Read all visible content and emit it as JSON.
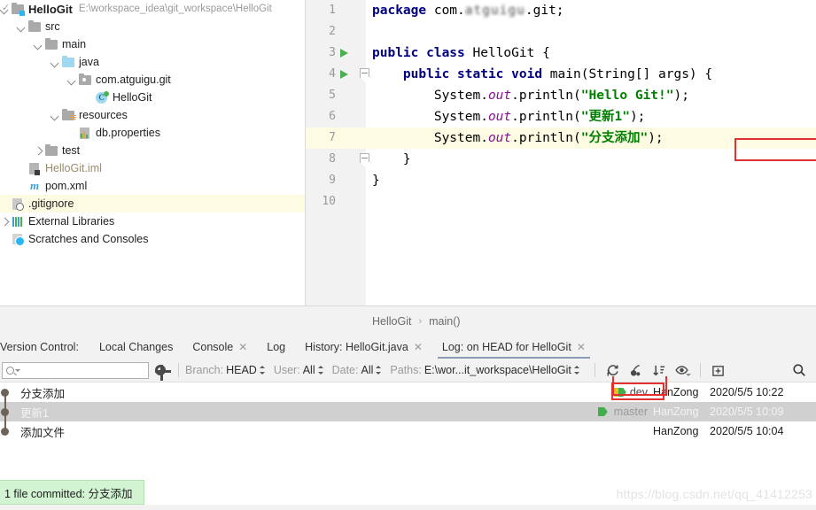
{
  "project_tree": {
    "rows": [
      {
        "label": "HelloGit",
        "path_note": "E:\\workspace_idea\\git_workspace\\HelloGit",
        "icon": "project-folder-icon",
        "indent": 13,
        "arrow": "down",
        "bold": true,
        "selected": false
      },
      {
        "label": "src",
        "path_note": "",
        "icon": "folder-gray-icon",
        "indent": 32,
        "arrow": "down",
        "bold": false,
        "selected": false
      },
      {
        "label": "main",
        "path_note": "",
        "icon": "folder-gray-icon",
        "indent": 51,
        "arrow": "down",
        "bold": false,
        "selected": false
      },
      {
        "label": "java",
        "path_note": "",
        "icon": "folder-source-icon",
        "indent": 70,
        "arrow": "down",
        "bold": false,
        "selected": false
      },
      {
        "label": "com.atguigu.git",
        "path_note": "",
        "icon": "package-icon",
        "indent": 89,
        "arrow": "down",
        "bold": false,
        "selected": false
      },
      {
        "label": "HelloGit",
        "path_note": "",
        "icon": "java-class-icon",
        "indent": 108,
        "arrow": "none",
        "bold": false,
        "selected": false
      },
      {
        "label": "resources",
        "path_note": "",
        "icon": "folder-resources-icon",
        "indent": 70,
        "arrow": "down",
        "bold": false,
        "selected": false
      },
      {
        "label": "db.properties",
        "path_note": "",
        "icon": "properties-file-icon",
        "indent": 89,
        "arrow": "none",
        "bold": false,
        "selected": false
      },
      {
        "label": "test",
        "path_note": "",
        "icon": "folder-gray-icon",
        "indent": 51,
        "arrow": "right",
        "bold": false,
        "selected": false
      },
      {
        "label": "HelloGit.iml",
        "path_note": "",
        "icon": "iml-file-icon",
        "indent": 32,
        "arrow": "none",
        "bold": false,
        "selected": false,
        "muted": true
      },
      {
        "label": "pom.xml",
        "path_note": "",
        "icon": "maven-icon",
        "indent": 32,
        "arrow": "none",
        "bold": false,
        "selected": false
      },
      {
        "label": ".gitignore",
        "path_note": "",
        "icon": "gitignore-icon",
        "indent": 13,
        "arrow": "none",
        "bold": false,
        "selected": true
      },
      {
        "label": "External Libraries",
        "path_note": "",
        "icon": "external-libraries-icon",
        "indent": 13,
        "arrow": "right",
        "bold": false,
        "selected": false
      },
      {
        "label": "Scratches and Consoles",
        "path_note": "",
        "icon": "scratches-icon",
        "indent": 13,
        "arrow": "none",
        "bold": false,
        "selected": false
      }
    ]
  },
  "editor": {
    "line_numbers": [
      "1",
      "2",
      "3",
      "4",
      "5",
      "6",
      "7",
      "8",
      "9",
      "10"
    ],
    "lines": [
      {
        "n": 1,
        "tokens": [
          {
            "t": "package ",
            "c": "kw"
          },
          {
            "t": "com.",
            "c": "plain"
          },
          {
            "t": "atguigu",
            "c": "blur"
          },
          {
            "t": ".git;",
            "c": "plain"
          }
        ]
      },
      {
        "n": 2,
        "tokens": []
      },
      {
        "n": 3,
        "tokens": [
          {
            "t": "public class ",
            "c": "kw"
          },
          {
            "t": "HelloGit {",
            "c": "plain"
          }
        ]
      },
      {
        "n": 4,
        "tokens": [
          {
            "t": "    ",
            "c": "plain"
          },
          {
            "t": "public static void ",
            "c": "kw"
          },
          {
            "t": "main(String[] args) {",
            "c": "plain"
          }
        ]
      },
      {
        "n": 5,
        "tokens": [
          {
            "t": "        System.",
            "c": "plain"
          },
          {
            "t": "out",
            "c": "fld"
          },
          {
            "t": ".println(",
            "c": "plain"
          },
          {
            "t": "\"Hello Git!\"",
            "c": "str"
          },
          {
            "t": ");",
            "c": "plain"
          }
        ]
      },
      {
        "n": 6,
        "tokens": [
          {
            "t": "        System.",
            "c": "plain"
          },
          {
            "t": "out",
            "c": "fld"
          },
          {
            "t": ".println(",
            "c": "plain"
          },
          {
            "t": "\"更新1\"",
            "c": "str"
          },
          {
            "t": ");",
            "c": "plain"
          }
        ]
      },
      {
        "n": 7,
        "tokens": [
          {
            "t": "        System.",
            "c": "plain"
          },
          {
            "t": "out",
            "c": "fld"
          },
          {
            "t": ".println(",
            "c": "plain"
          },
          {
            "t": "\"分支添加\"",
            "c": "str"
          },
          {
            "t": ");",
            "c": "plain"
          }
        ]
      },
      {
        "n": 8,
        "tokens": [
          {
            "t": "    }",
            "c": "plain"
          }
        ]
      },
      {
        "n": 9,
        "tokens": [
          {
            "t": "}",
            "c": "plain"
          }
        ]
      },
      {
        "n": 10,
        "tokens": []
      }
    ],
    "highlighted_line": 7,
    "run_gutter_lines": [
      3,
      4
    ],
    "fold_gutter_lines": [
      4,
      8
    ],
    "highlight_box_color": "#e03030"
  },
  "breadcrumb": {
    "items": [
      "HelloGit",
      "main()"
    ],
    "separator": "›"
  },
  "vcs": {
    "title": "Version Control:",
    "tabs": [
      {
        "label": "Local Changes",
        "closable": false,
        "active": false
      },
      {
        "label": "Console",
        "closable": true,
        "active": false
      },
      {
        "label": "Log",
        "closable": false,
        "active": false
      },
      {
        "label": "History: HelloGit.java",
        "closable": true,
        "active": false
      },
      {
        "label": "Log: on HEAD for HelloGit",
        "closable": true,
        "active": true
      }
    ],
    "search_placeholder": "",
    "search_value": "",
    "filters": [
      {
        "key": "Branch:",
        "value": "HEAD"
      },
      {
        "key": "User:",
        "value": "All"
      },
      {
        "key": "Date:",
        "value": "All"
      },
      {
        "key": "Paths:",
        "value": "E:\\wor...it_workspace\\HelloGit"
      }
    ],
    "toolbar_icons": [
      "refresh-icon",
      "cherry-pick-icon",
      "sort-icon",
      "show-details-icon",
      "new-tab-icon"
    ],
    "search_icon": "search-icon",
    "commits": [
      {
        "subject": "分支添加",
        "ref": {
          "name": "dev",
          "style": "head-tag"
        },
        "author": "HanZong",
        "date": "2020/5/5 10:22",
        "selected": false,
        "graph": "first"
      },
      {
        "subject": "更新1",
        "ref": {
          "name": "master",
          "style": "branch-tag"
        },
        "author": "HanZong",
        "date": "2020/5/5 10:09",
        "selected": true,
        "graph": "middle"
      },
      {
        "subject": "添加文件",
        "ref": null,
        "author": "HanZong",
        "date": "2020/5/5 10:04",
        "selected": false,
        "graph": "last"
      }
    ]
  },
  "notification": {
    "message": "1 file committed: 分支添加",
    "background": "#d2f4d2"
  },
  "watermark": {
    "text": "https://blog.csdn.net/qq_41412253"
  }
}
